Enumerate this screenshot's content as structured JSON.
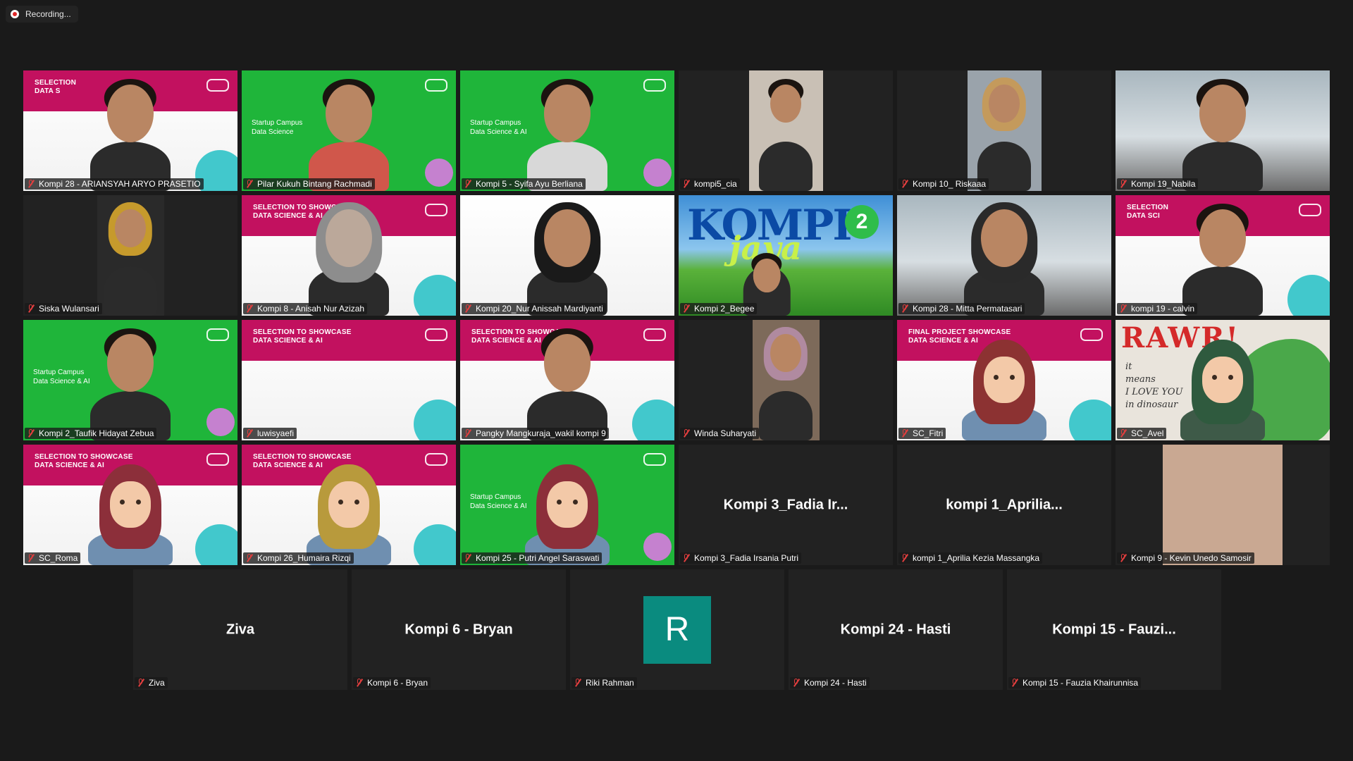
{
  "recording": {
    "label": "Recording..."
  },
  "colors": {
    "active_border": "#d8e34c",
    "muted_mic": "#e13e3e",
    "avatar_R": "#0a8b7f",
    "background": "#1a1a1a"
  },
  "participants": [
    {
      "name": "Kompi 28 - ARIANSYAH ARYO PRASETIO",
      "bg": "pink",
      "banner": "SELECTION\nDATA S"
    },
    {
      "name": "Pilar Kukuh Bintang Rachmadi",
      "bg": "green",
      "active": true,
      "slide_text": "Startup Campus\nData Science"
    },
    {
      "name": "Kompi 5 - Syifa Ayu Berliana",
      "bg": "green",
      "slide_text": "Startup Campus\nData Science & AI"
    },
    {
      "name": "kompi5_cia",
      "bg": "dark"
    },
    {
      "name": "Kompi 10_ Riskaaa",
      "bg": "dark"
    },
    {
      "name": "Kompi 19_Nabila",
      "bg": "room"
    },
    {
      "name": "Siska Wulansari",
      "bg": "dark"
    },
    {
      "name": "Kompi 8 - Anisah Nur Azizah",
      "bg": "pink",
      "banner": "SELECTION TO SHOWCASE\nDATA SCIENCE & AI"
    },
    {
      "name": "Kompi 20_Nur Anissah Mardiyanti",
      "bg": "white"
    },
    {
      "name": "Kompi 2_Begee",
      "bg": "sky",
      "overlay_title": "KOMPI",
      "overlay_sub": "jaya",
      "overlay_num": "2"
    },
    {
      "name": "Kompi 28 - Mitta Permatasari",
      "bg": "room"
    },
    {
      "name": "kompi 19 - calvin",
      "bg": "pink",
      "banner": "SELECTION\nDATA SCI"
    },
    {
      "name": "Kompi 2_Taufik Hidayat Zebua",
      "bg": "green",
      "slide_text": "Startup Campus\nData Science & AI"
    },
    {
      "name": "luwisyaefi",
      "bg": "pink",
      "banner": "SELECTION TO SHOWCASE\nDATA SCIENCE & AI"
    },
    {
      "name": "Pangky Mangkuraja_wakil kompi 9",
      "bg": "pink",
      "banner": "SELECTION TO SHOWCASE\nDATA SCIENCE & AI"
    },
    {
      "name": "Winda Suharyati",
      "bg": "dark"
    },
    {
      "name": "SC_Fitri",
      "bg": "pink",
      "banner": "FINAL PROJECT SHOWCASE\nDATA SCIENCE & AI"
    },
    {
      "name": "SC_Avel",
      "bg": "paper",
      "overlay_title": "RAWR!",
      "overlay_note": "it\nmeans\nI LOVE YOU\nin dinosaur"
    },
    {
      "name": "SC_Roma",
      "bg": "pink",
      "banner": "SELECTION TO SHOWCASE\nDATA SCIENCE & AI"
    },
    {
      "name": "Kompi 26_Humaira Rizqi",
      "bg": "pink",
      "banner": "SELECTION TO SHOWCASE\nDATA SCIENCE & AI"
    },
    {
      "name": "Kompi 25 - Putri Angel Saraswati",
      "bg": "green",
      "slide_text": "Startup Campus\nData Science & AI"
    },
    {
      "name": "Kompi 3_Fadia Irsania Putri",
      "bg": "dark",
      "display": "Kompi 3_Fadia Ir..."
    },
    {
      "name": "kompi 1_Aprilia Kezia Massangka",
      "bg": "dark",
      "display": "kompi  1_Aprilia..."
    },
    {
      "name": "Kompi 9 - Kevin Unedo Samosir",
      "bg": "dark"
    },
    {
      "name": "Ziva",
      "bg": "dark",
      "display": "Ziva"
    },
    {
      "name": "Kompi 6 - Bryan",
      "bg": "dark",
      "display": "Kompi 6 - Bryan"
    },
    {
      "name": "Riki Rahman",
      "bg": "dark",
      "initial": "R"
    },
    {
      "name": "Kompi 24 - Hasti",
      "bg": "dark",
      "display": "Kompi 24 - Hasti"
    },
    {
      "name": "Kompi 15 - Fauzia Khairunnisa",
      "bg": "dark",
      "display": "Kompi  15  - Fauzi..."
    }
  ]
}
